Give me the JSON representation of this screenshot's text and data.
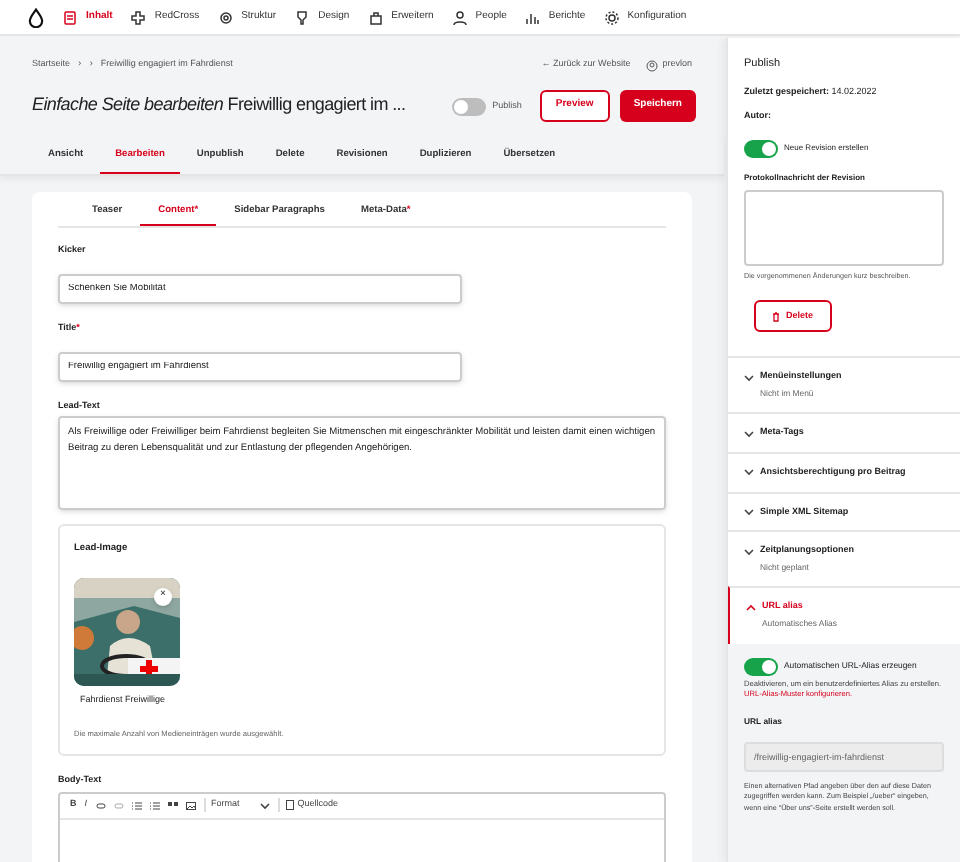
{
  "toolbar": {
    "items": [
      {
        "label": "Inhalt",
        "selected": true
      },
      {
        "label": "RedCross",
        "selected": false
      },
      {
        "label": "Struktur",
        "selected": false
      },
      {
        "label": "Design",
        "selected": false
      },
      {
        "label": "Erweitern",
        "selected": false
      },
      {
        "label": "People",
        "selected": false
      },
      {
        "label": "Berichte",
        "selected": false
      },
      {
        "label": "Konfiguration",
        "selected": false
      }
    ]
  },
  "breadcrumb": {
    "items": [
      "Startseite",
      "Freiwillig engagiert im Fahrdienst"
    ],
    "separators": [
      "›",
      "›"
    ]
  },
  "back_link": {
    "arrow": "←",
    "label": "Zurück zur Website"
  },
  "user": "prevlon",
  "required_mark": "*",
  "title": {
    "type": "Einfache Seite bearbeiten",
    "name": "Freiwillig engagiert im ..."
  },
  "publish_toggle": {
    "label": "Publish",
    "on": false
  },
  "buttons": {
    "preview": "Preview",
    "save": "Speichern"
  },
  "tabs": [
    {
      "label": "Ansicht",
      "selected": false
    },
    {
      "label": "Bearbeiten",
      "selected": true
    },
    {
      "label": "Unpublish",
      "selected": false
    },
    {
      "label": "Delete",
      "selected": false
    },
    {
      "label": "Revisionen",
      "selected": false
    },
    {
      "label": "Duplizieren",
      "selected": false
    },
    {
      "label": "Übersetzen",
      "selected": false
    }
  ],
  "inner_tabs": [
    {
      "label": "Teaser",
      "selected": false,
      "required": false
    },
    {
      "label": "Content",
      "selected": true,
      "required": true
    },
    {
      "label": "Sidebar Paragraphs",
      "selected": false,
      "required": false
    },
    {
      "label": "Meta-Data",
      "selected": false,
      "required": true
    }
  ],
  "fields": {
    "kicker": {
      "label": "Kicker",
      "value": "Schenken Sie Mobilität"
    },
    "title": {
      "label": "Title",
      "required": true,
      "value": "Freiwillig engagiert im Fahrdienst"
    },
    "lead_text": {
      "label": "Lead-Text",
      "value": "Als Freiwillige oder Freiwilliger beim Fahrdienst begleiten Sie Mitmenschen mit eingeschränkter Mobilität und leisten damit einen wichtigen Beitrag zu deren Lebensqualität und zur Entlastung der pflegenden Angehörigen."
    }
  },
  "lead_image": {
    "title": "Lead-Image",
    "remove": "×",
    "caption": "Fahrdienst Freiwillige",
    "note": "Die maximale Anzahl von Medieneinträgen wurde ausgewählt."
  },
  "body_text": {
    "label": "Body-Text",
    "bold": "B",
    "italic": "I",
    "format": "Format",
    "source": "Quellcode"
  },
  "sidebar": {
    "title": "Publish",
    "saved_label": "Zuletzt gespeichert:",
    "saved_value": "14.02.2022",
    "author_label": "Autor:",
    "new_revision": {
      "label": "Neue Revision erstellen",
      "on": true
    },
    "log_label": "Protokollnachricht der Revision",
    "log_hint": "Die vorgenommenen Änderungen kurz beschreiben.",
    "delete": "Delete",
    "sections": [
      {
        "title": "Menüeinstellungen",
        "summary": "Nicht im Menü",
        "expanded": false
      },
      {
        "title": "Meta-Tags",
        "expanded": false
      },
      {
        "title": "Ansichtsberechtigung pro Beitrag",
        "expanded": false
      },
      {
        "title": "Simple XML Sitemap",
        "expanded": false
      },
      {
        "title": "Zeitplanungsoptionen",
        "summary": "Nicht geplant",
        "expanded": false
      },
      {
        "title": "URL alias",
        "summary": "Automatisches Alias",
        "expanded": true
      }
    ],
    "url_alias": {
      "auto": {
        "label": "Automatischen URL-Alias erzeugen",
        "on": true
      },
      "help": "Deaktivieren, um ein benutzerdefiniertes Alias zu erstellen.",
      "help_link": "URL-Alias-Muster konfigurieren.",
      "field_label": "URL alias",
      "value": "/freiwillig-engagiert-im-fahrdienst",
      "hint": "Einen alternativen Pfad angeben über den auf diese Daten zugegriffen werden kann. Zum Beispiel „/ueber“ eingeben, wenn eine “Über uns”-Seite erstellt werden soll."
    }
  }
}
